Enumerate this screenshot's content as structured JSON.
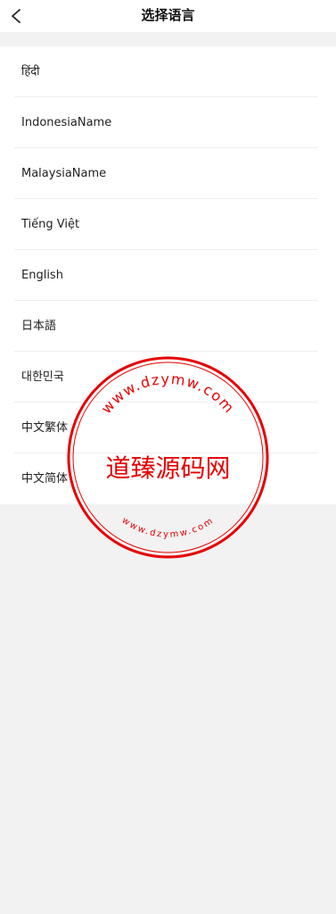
{
  "header": {
    "title": "选择语言",
    "back_icon": "chevron-left-icon"
  },
  "languages": [
    "हिंदी",
    "IndonesiaName",
    "MalaysiaName",
    "Tiếng Việt",
    "English",
    "日本語",
    "대한민국",
    "中文繁体",
    "中文简体"
  ],
  "watermark": {
    "center_text": "道臻源码网",
    "top_arc": "www.dzymw.com",
    "bottom_arc": "www.dzymw.com",
    "color": "#e60000"
  },
  "colors": {
    "background": "#f2f2f2",
    "panel": "#ffffff",
    "divider": "#ededed"
  }
}
